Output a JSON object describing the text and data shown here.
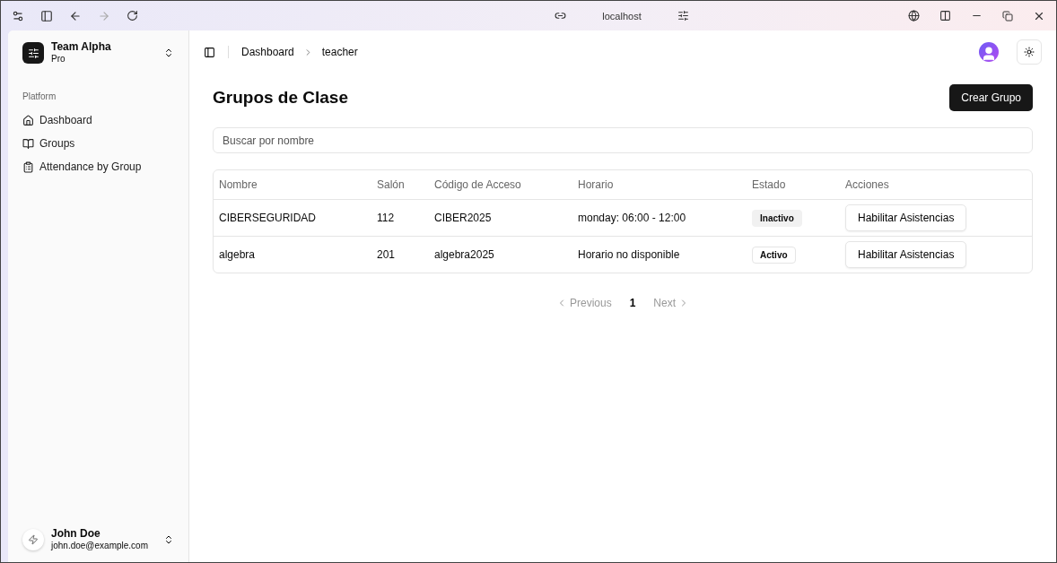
{
  "browser": {
    "address": "localhost"
  },
  "sidebar": {
    "team": {
      "name": "Team Alpha",
      "plan": "Pro"
    },
    "section": "Platform",
    "items": [
      {
        "label": "Dashboard"
      },
      {
        "label": "Groups"
      },
      {
        "label": "Attendance by Group"
      }
    ],
    "user": {
      "name": "John Doe",
      "email": "john.doe@example.com"
    }
  },
  "breadcrumb": [
    "Dashboard",
    "teacher"
  ],
  "page": {
    "title": "Grupos de Clase",
    "create_button": "Crear Grupo",
    "search": {
      "placeholder": "Buscar por nombre"
    }
  },
  "table": {
    "columns": [
      "Nombre",
      "Salón",
      "Código de Acceso",
      "Horario",
      "Estado",
      "Acciones"
    ],
    "rows": [
      {
        "name": "CIBERSEGURIDAD",
        "room": "112",
        "code": "CIBER2025",
        "schedule": "monday: 06:00 - 12:00",
        "status": "Inactivo",
        "active": false,
        "action": "Habilitar Asistencias"
      },
      {
        "name": "algebra",
        "room": "201",
        "code": "algebra2025",
        "schedule": "Horario no disponible",
        "status": "Activo",
        "active": true,
        "action": "Habilitar Asistencias"
      }
    ]
  },
  "pagination": {
    "previous": "Previous",
    "next": "Next",
    "previous_disabled": true,
    "next_disabled": true,
    "pages": [
      {
        "label": "1",
        "selected": true
      }
    ]
  }
}
